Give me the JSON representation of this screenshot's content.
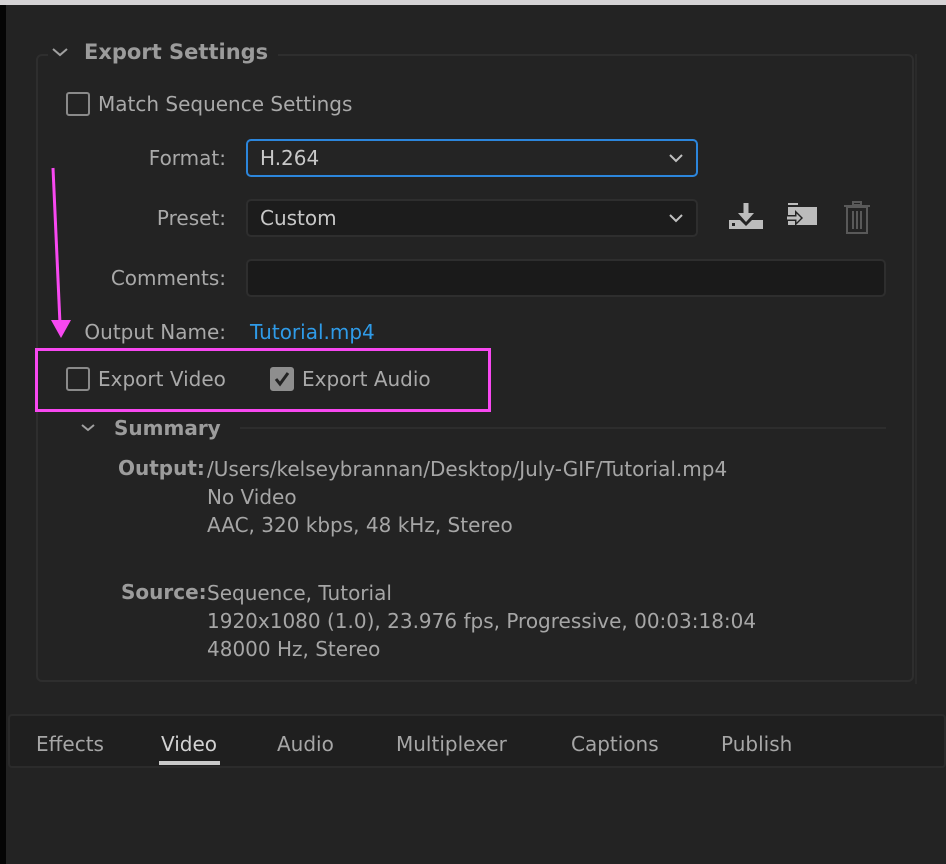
{
  "export_settings": {
    "section_title": "Export Settings",
    "match_sequence": {
      "label": "Match Sequence Settings",
      "checked": false
    },
    "format": {
      "label": "Format:",
      "value": "H.264"
    },
    "preset": {
      "label": "Preset:",
      "value": "Custom"
    },
    "preset_actions": [
      "save-preset-icon",
      "import-preset-icon",
      "delete-preset-icon"
    ],
    "comments": {
      "label": "Comments:",
      "value": ""
    },
    "output_name": {
      "label": "Output Name:",
      "value": "Tutorial.mp4"
    },
    "export_video": {
      "label": "Export Video",
      "checked": false
    },
    "export_audio": {
      "label": "Export Audio",
      "checked": true
    }
  },
  "summary": {
    "title": "Summary",
    "output_label": "Output:",
    "output_lines": [
      "/Users/kelseybrannan/Desktop/July-GIF/Tutorial.mp4",
      "No Video",
      "AAC, 320 kbps, 48 kHz, Stereo"
    ],
    "source_label": "Source:",
    "source_lines": [
      "Sequence, Tutorial",
      "1920x1080 (1.0), 23.976 fps, Progressive, 00:03:18:04",
      "48000 Hz, Stereo"
    ]
  },
  "tabs": [
    {
      "label": "Effects",
      "active": false
    },
    {
      "label": "Video",
      "active": true
    },
    {
      "label": "Audio",
      "active": false
    },
    {
      "label": "Multiplexer",
      "active": false
    },
    {
      "label": "Captions",
      "active": false
    },
    {
      "label": "Publish",
      "active": false
    }
  ],
  "annotation": {
    "color": "#f748f0"
  }
}
